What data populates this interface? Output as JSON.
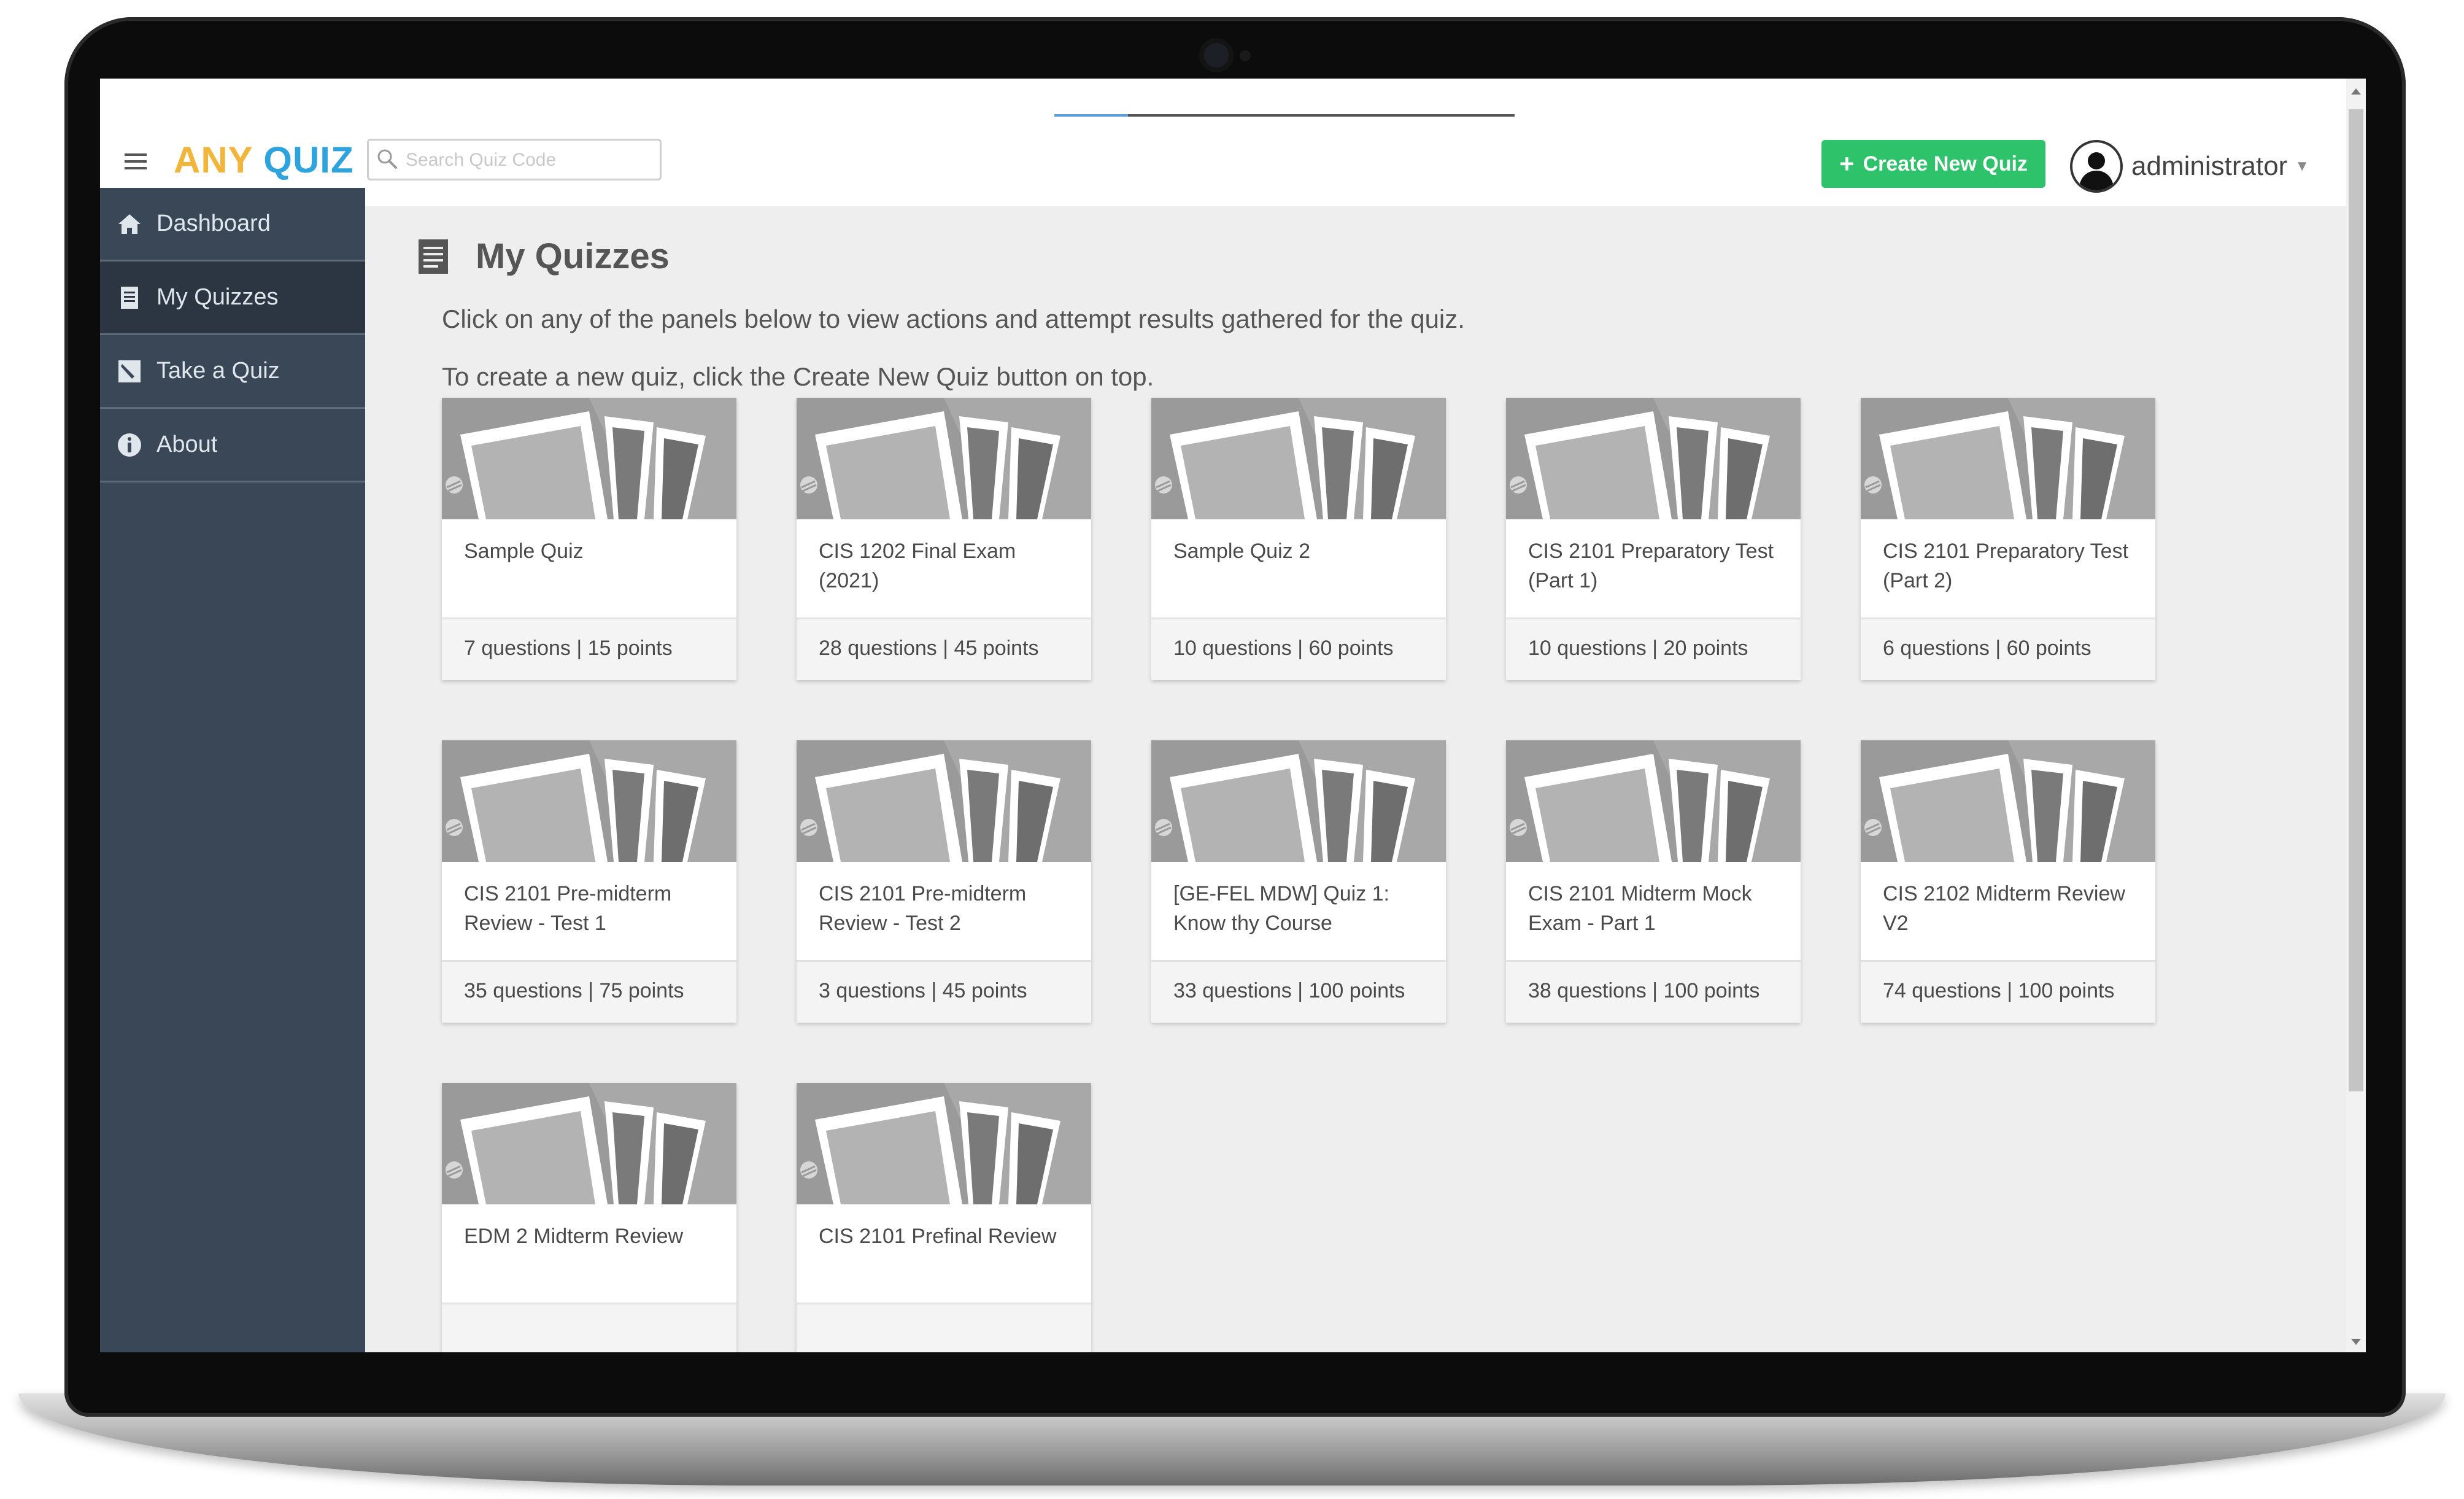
{
  "app": {
    "logo_part1": "ANY",
    "logo_part2": "QUIZ",
    "search_placeholder": "Search Quiz Code",
    "create_button_label": "Create New Quiz",
    "user_name": "administrator"
  },
  "sidebar": {
    "items": [
      {
        "label": "Dashboard",
        "icon": "home-icon"
      },
      {
        "label": "My Quizzes",
        "icon": "document-icon",
        "active": true
      },
      {
        "label": "Take a Quiz",
        "icon": "edit-icon"
      },
      {
        "label": "About",
        "icon": "info-icon"
      }
    ]
  },
  "main": {
    "title": "My Quizzes",
    "intro_line1": "Click on any of the panels below to view actions and attempt results gathered for the quiz.",
    "intro_line2": "To create a new quiz, click the Create New Quiz button on top."
  },
  "quizzes": [
    {
      "title": "Sample Quiz",
      "meta": "7 questions | 15 points"
    },
    {
      "title": "CIS 1202 Final Exam (2021)",
      "meta": "28 questions | 45 points"
    },
    {
      "title": "Sample Quiz 2",
      "meta": "10 questions | 60 points"
    },
    {
      "title": "CIS 2101 Preparatory Test (Part 1)",
      "meta": "10 questions | 20 points"
    },
    {
      "title": "CIS 2101 Preparatory Test (Part 2)",
      "meta": "6 questions | 60 points"
    },
    {
      "title": "CIS 2101 Pre-midterm Review - Test 1",
      "meta": "35 questions | 75 points"
    },
    {
      "title": "CIS 2101 Pre-midterm Review - Test 2",
      "meta": "3 questions | 45 points"
    },
    {
      "title": "[GE-FEL MDW] Quiz 1: Know thy Course",
      "meta": "33 questions | 100 points"
    },
    {
      "title": "CIS 2101 Midterm Mock Exam - Part 1",
      "meta": "38 questions | 100 points"
    },
    {
      "title": "CIS 2102 Midterm Review V2",
      "meta": "74 questions | 100 points"
    },
    {
      "title": "EDM 2 Midterm Review",
      "meta": ""
    },
    {
      "title": "CIS 2101 Prefinal Review",
      "meta": ""
    }
  ],
  "colors": {
    "logo_any": "#f2b53c",
    "logo_quiz": "#2ea3dd",
    "create_button": "#2ec26a",
    "sidebar_bg": "#3a4756",
    "sidebar_active": "#2b3642"
  }
}
